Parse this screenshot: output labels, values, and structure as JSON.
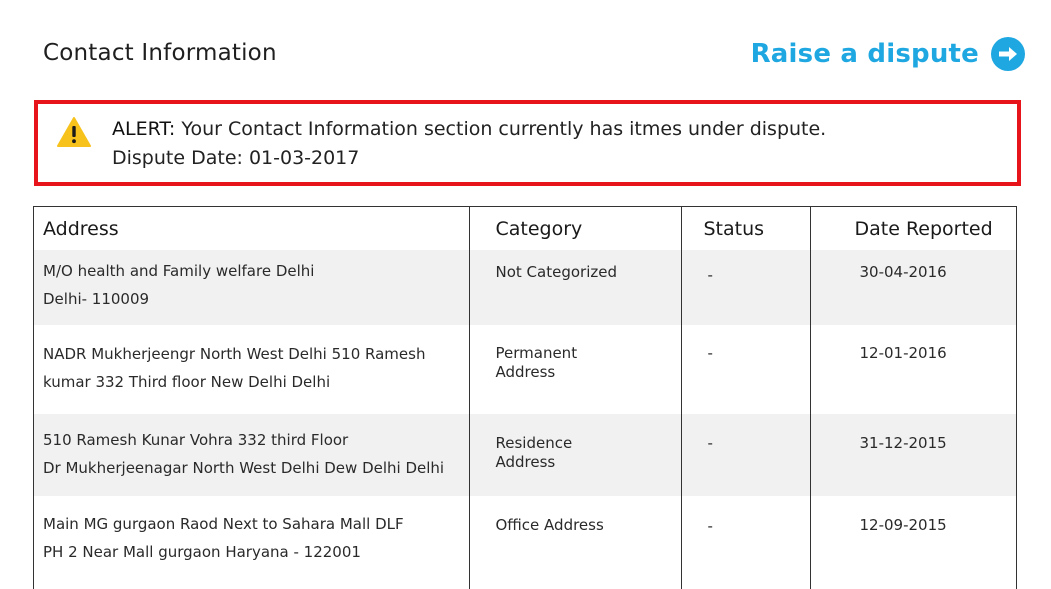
{
  "header": {
    "title": "Contact Information",
    "dispute_link_label": "Raise a dispute",
    "dispute_icon": "arrow-right-circle-icon",
    "accent_color": "#1ea7e1"
  },
  "alert": {
    "icon": "warning-icon",
    "prefix": "ALERT:",
    "message": "Your Contact Information section currently has itmes under dispute.",
    "dispute_date": "Dispute Date: 01-03-2017",
    "border_color": "#e8141b"
  },
  "table": {
    "columns": [
      "Address",
      "Category",
      "Status",
      "Date Reported"
    ],
    "rows": [
      {
        "address_line1": "M/O health and Family welfare Delhi",
        "address_line2": "Delhi- 110009",
        "category_line1": "Not Categorized",
        "category_line2": "",
        "status": "-",
        "date_reported": "30-04-2016"
      },
      {
        "address_line1": "NADR Mukherjeengr North West Delhi 510 Ramesh",
        "address_line2": "kumar 332 Third floor New Delhi Delhi",
        "category_line1": "Permanent",
        "category_line2": "Address",
        "status": "-",
        "date_reported": "12-01-2016"
      },
      {
        "address_line1": "510 Ramesh Kunar Vohra 332 third Floor",
        "address_line2": "Dr Mukherjeenagar North West Delhi Dew Delhi Delhi",
        "category_line1": "Residence",
        "category_line2": "Address",
        "status": "-",
        "date_reported": "31-12-2015"
      },
      {
        "address_line1": "Main MG gurgaon Raod Next to Sahara Mall DLF",
        "address_line2": "PH 2 Near Mall gurgaon Haryana - 122001",
        "category_line1": "Office Address",
        "category_line2": "",
        "status": "-",
        "date_reported": "12-09-2015"
      }
    ]
  }
}
